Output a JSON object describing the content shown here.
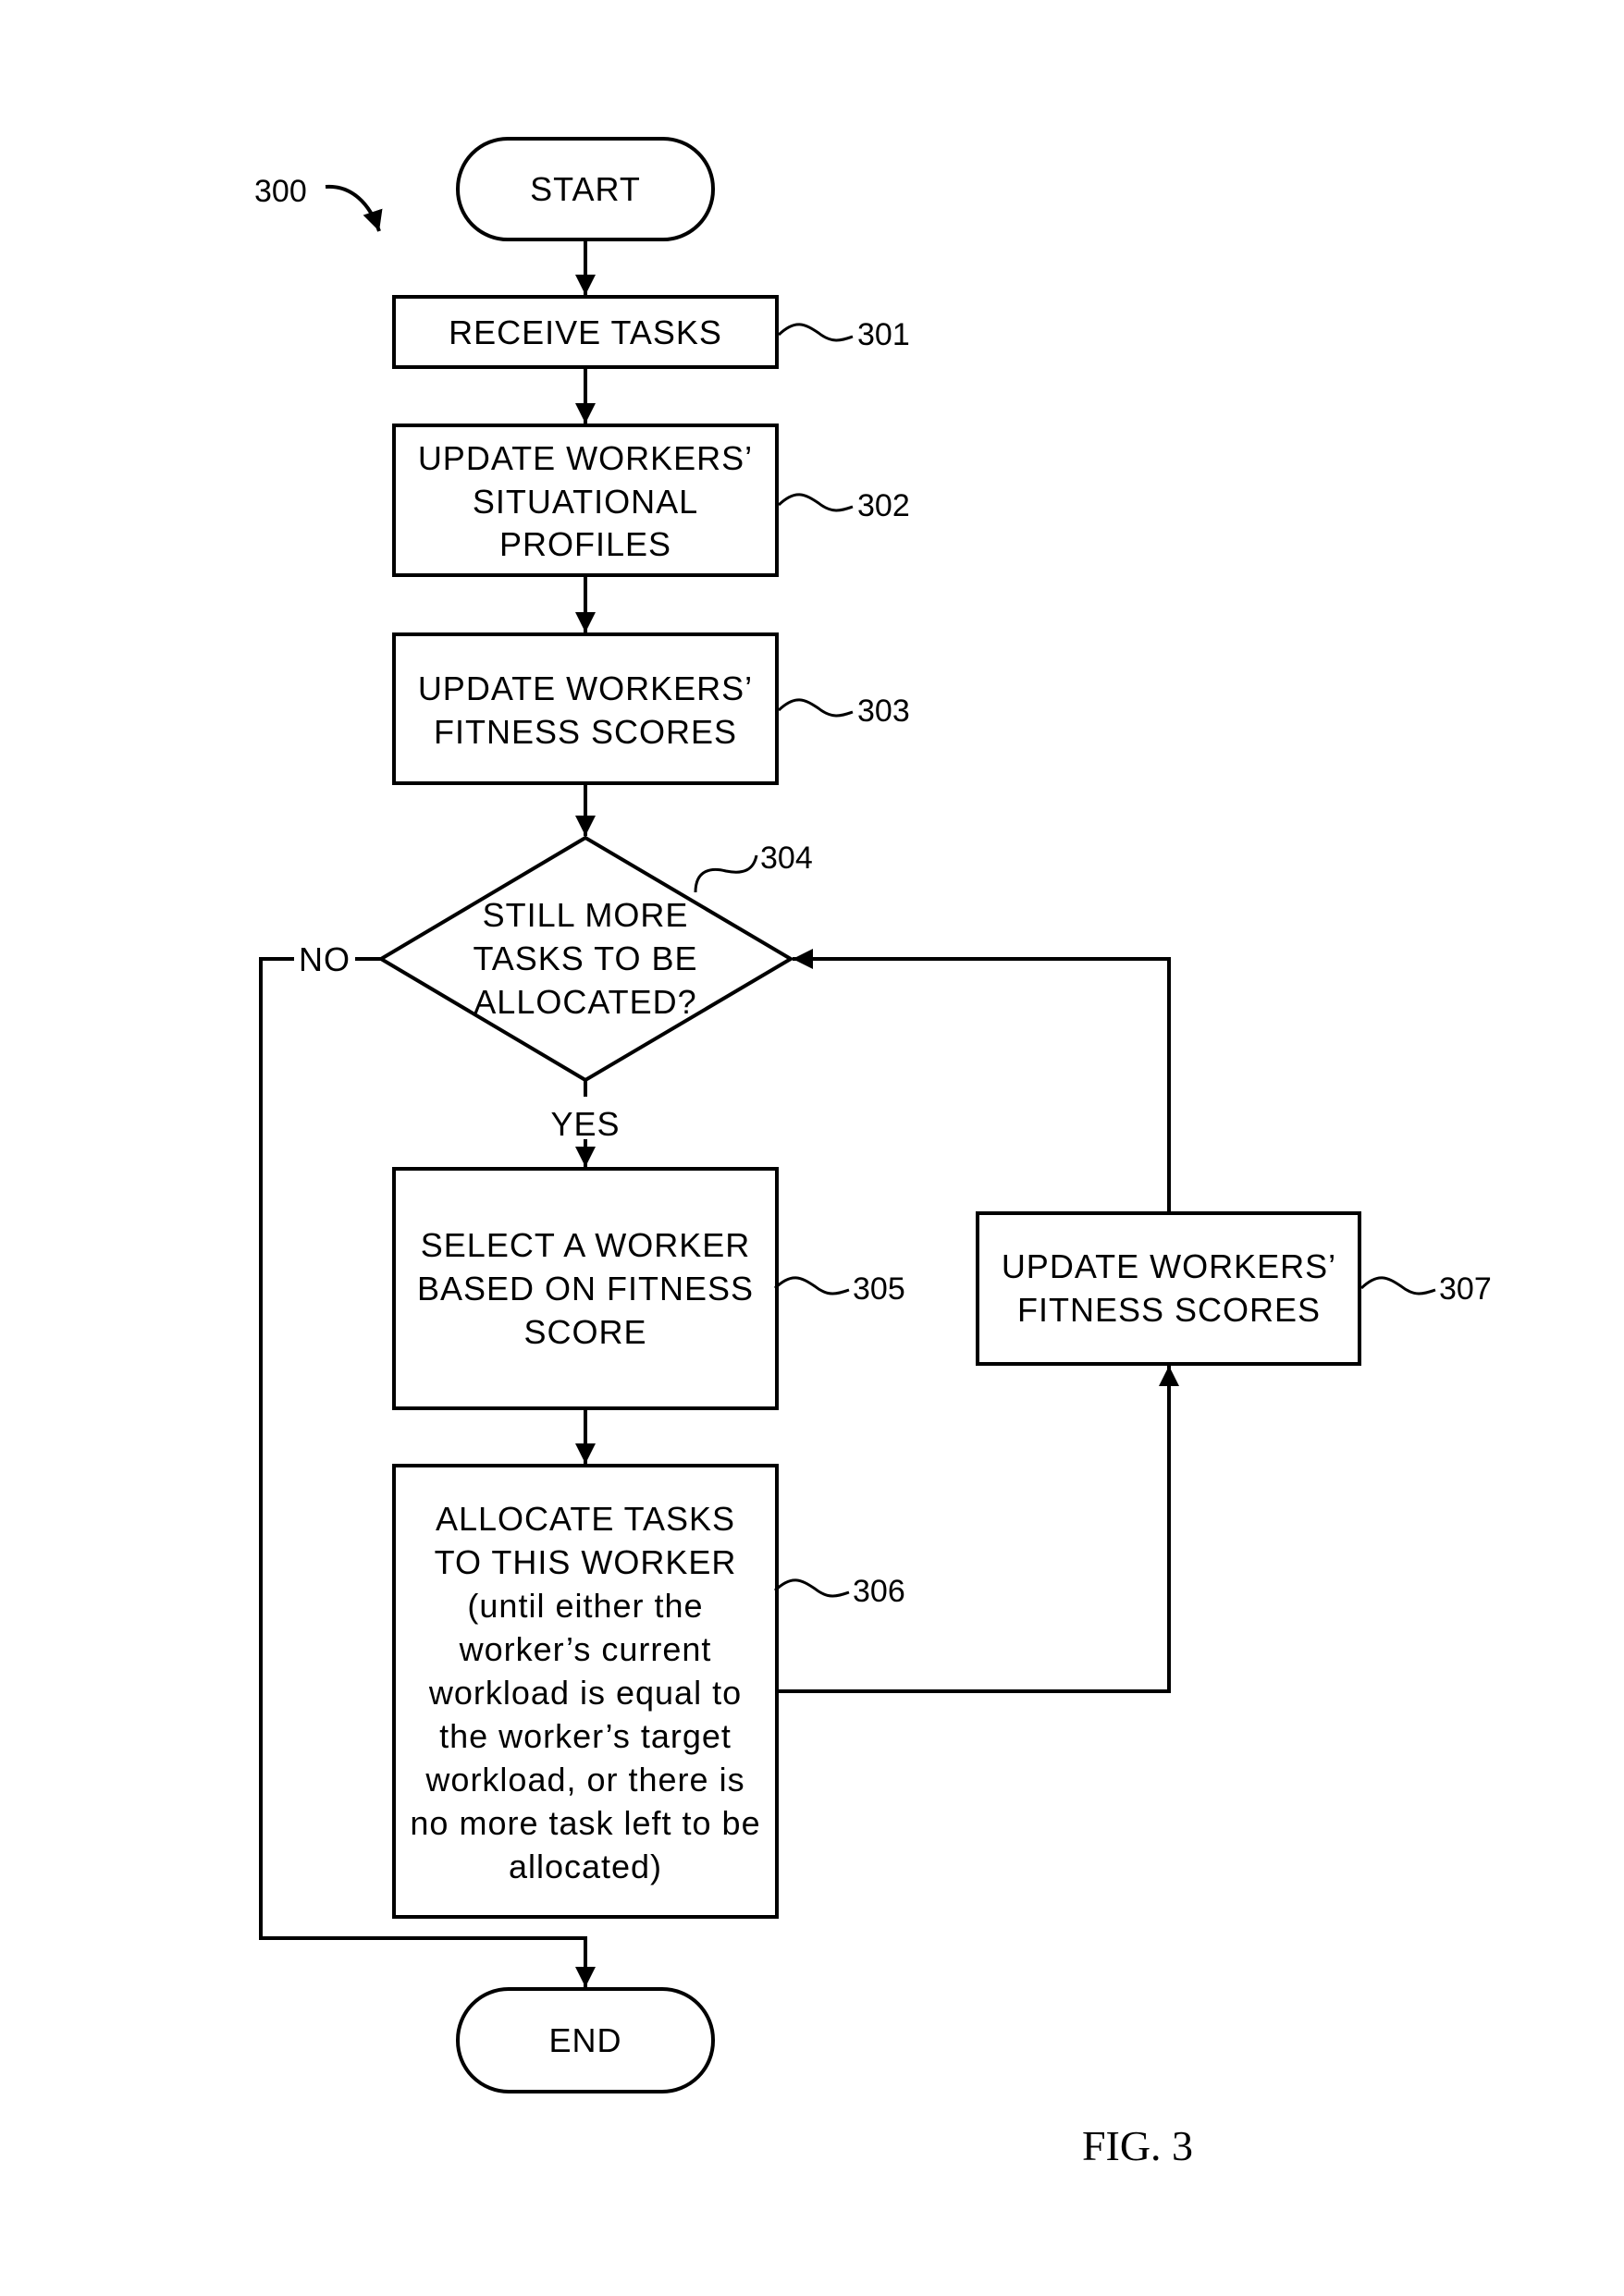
{
  "figure": {
    "caption": "FIG. 3",
    "reference": "300"
  },
  "nodes": {
    "start": {
      "label": "START"
    },
    "s301": {
      "ref": "301",
      "lines": [
        "RECEIVE TASKS"
      ]
    },
    "s302": {
      "ref": "302",
      "lines": [
        "UPDATE WORKERS’",
        "SITUATIONAL",
        "PROFILES"
      ]
    },
    "s303": {
      "ref": "303",
      "lines": [
        "UPDATE WORKERS’",
        "FITNESS SCORES"
      ]
    },
    "s304": {
      "ref": "304",
      "lines": [
        "STILL MORE",
        "TASKS TO BE",
        "ALLOCATED?"
      ]
    },
    "s305": {
      "ref": "305",
      "lines": [
        "SELECT A WORKER",
        "BASED ON FITNESS",
        "SCORE"
      ]
    },
    "s306": {
      "ref": "306",
      "lines": [
        "ALLOCATE TASKS",
        "TO THIS WORKER",
        "(until either the",
        "worker’s current",
        "workload is equal to",
        "the worker’s target",
        "workload, or there is",
        "no more task left to be",
        "allocated)"
      ]
    },
    "s307": {
      "ref": "307",
      "lines": [
        "UPDATE WORKERS’",
        "FITNESS SCORES"
      ]
    },
    "end": {
      "label": "END"
    }
  },
  "edges": {
    "no_label": "NO",
    "yes_label": "YES"
  }
}
